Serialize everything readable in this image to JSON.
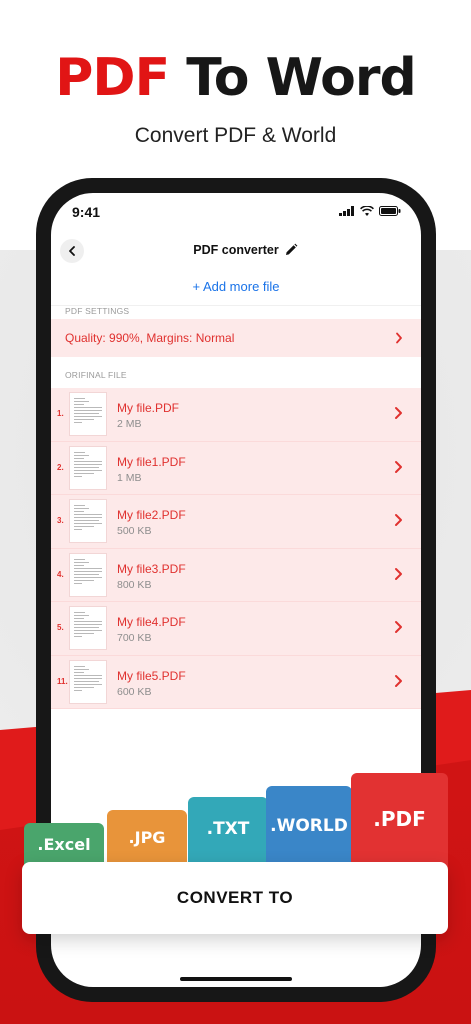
{
  "headline": {
    "part1": "PDF",
    "part2": " To Word"
  },
  "subtitle": "Convert PDF & World",
  "status_bar": {
    "time": "9:41"
  },
  "nav": {
    "title": "PDF converter"
  },
  "add_more": "+ Add more file",
  "settings": {
    "section_label": "PDF SETTINGS",
    "value": "Quality: 990%, Margins: Normal"
  },
  "files": {
    "section_label": "ORIFINAL FILE",
    "items": [
      {
        "index": "1.",
        "name": "My file.PDF",
        "size": "2 MB"
      },
      {
        "index": "2.",
        "name": "My file1.PDF",
        "size": "1 MB"
      },
      {
        "index": "3.",
        "name": "My file2.PDF",
        "size": "500 KB"
      },
      {
        "index": "4.",
        "name": "My file3.PDF",
        "size": "800 KB"
      },
      {
        "index": "5.",
        "name": "My file4.PDF",
        "size": "700 KB"
      },
      {
        "index": "11.",
        "name": "My file5.PDF",
        "size": "600 KB"
      }
    ]
  },
  "formats": [
    ".Excel",
    ".JPG",
    ".TXT",
    ".WORLD",
    ".PDF"
  ],
  "convert_label": "CONVERT TO",
  "colors": {
    "brand_red": "#e11515",
    "link_blue": "#1a73e8",
    "row_bg": "#fde9e9"
  }
}
